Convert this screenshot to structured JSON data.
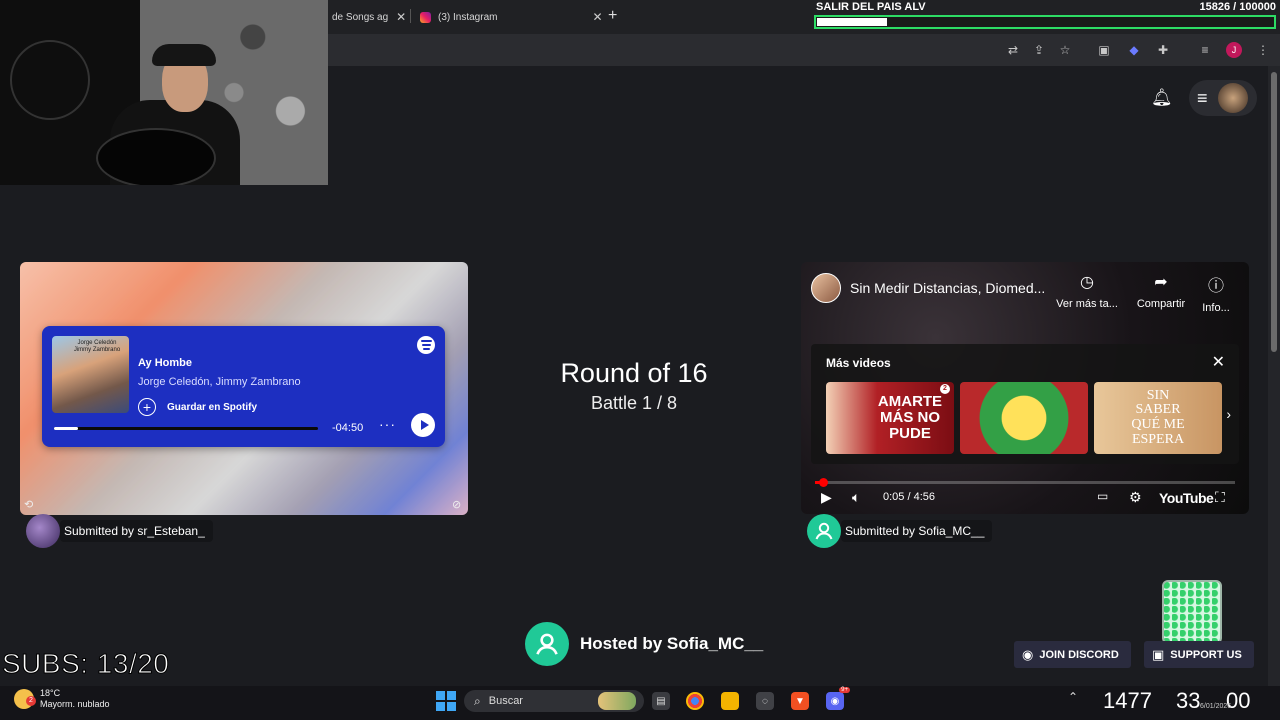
{
  "browser": {
    "tabs": [
      {
        "label": "de Songs ag"
      },
      {
        "label": "(3) Instagram"
      }
    ],
    "new_tab": "+",
    "profile_initial": "J"
  },
  "goal": {
    "title": "SALIR DEL PAIS ALV",
    "count": "15826 / 100000",
    "progress": 0.158
  },
  "battle": {
    "round": "Round of 16",
    "battle": "Battle 1 / 8"
  },
  "left": {
    "spotify": {
      "title": "Ay Hombe",
      "artist": "Jorge Celedón, Jimmy Zambrano",
      "save_label": "Guardar en Spotify",
      "time_remaining": "-04:50",
      "progress": 0.09,
      "cover_text": "Jorge Celedón Jimmy Zambrano"
    },
    "submitted_by": "Submitted by sr_Esteban_"
  },
  "right": {
    "youtube": {
      "title": "Sin Medir Distancias, Diomed...",
      "watch_later": "Ver más ta...",
      "share": "Compartir",
      "info": "Info...",
      "more_videos": "Más videos",
      "thumbs": [
        "AMARTE MÁS NO PUDE",
        "",
        "SIN SABER QUÉ ME ESPERA"
      ],
      "time": "0:05 / 4:56",
      "progress": 0.018,
      "logo": "YouTube"
    },
    "submitted_by": "Submitted by Sofia_MC__"
  },
  "host": "Hosted by Sofia_MC__",
  "subs": "SUBS: 13/20",
  "buttons": {
    "discord": "JOIN DISCORD",
    "support": "SUPPORT US"
  },
  "taskbar": {
    "temp": "18°C",
    "weather": "Mayorm. nublado",
    "search": "Buscar",
    "overlay_a": "1477",
    "overlay_b": "33",
    "overlay_c": "00",
    "date": "6/01/2026",
    "weather_badge": "2",
    "discord_badge": "9+"
  },
  "colors": {
    "spotify_card": "#1d2fc1",
    "goal_border": "#2ddc65",
    "host_avatar": "#20c997",
    "yt_red": "#ff0000"
  }
}
